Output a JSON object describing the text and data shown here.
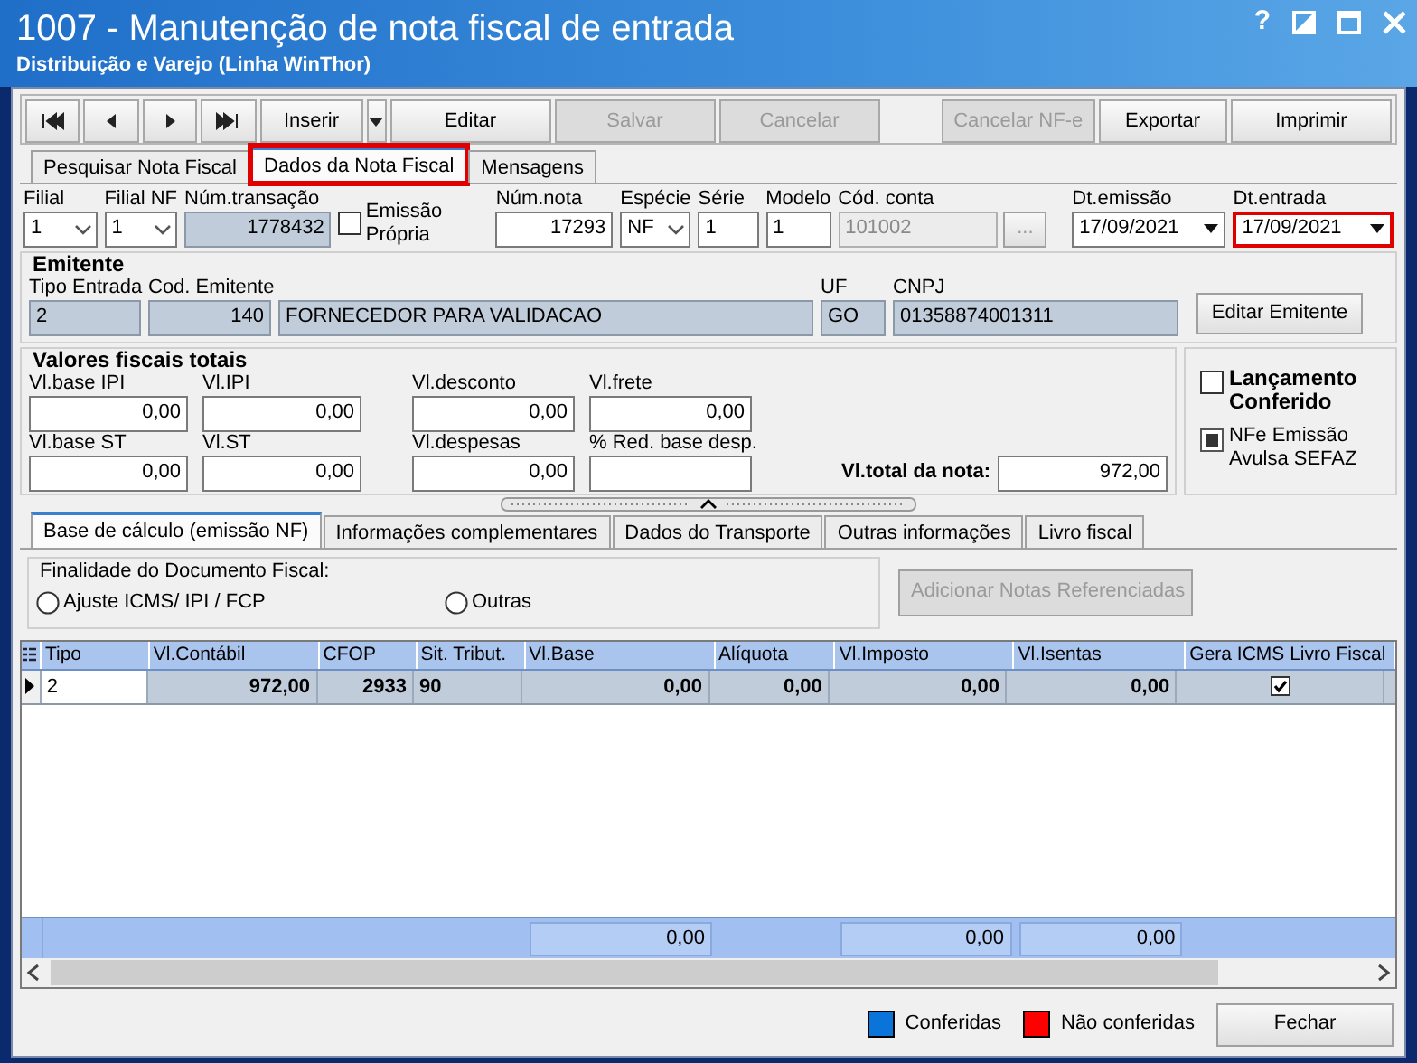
{
  "window": {
    "title": "1007 - Manutenção de nota fiscal de entrada",
    "subtitle": "Distribuição e Varejo (Linha WinThor)",
    "controls": [
      {
        "kind": "help",
        "label": "?"
      },
      {
        "kind": "restore"
      },
      {
        "kind": "maximize"
      },
      {
        "kind": "close"
      }
    ]
  },
  "toolbar": [
    {
      "kind": "first",
      "disabled": false
    },
    {
      "kind": "prev",
      "disabled": false
    },
    {
      "kind": "next",
      "disabled": false
    },
    {
      "kind": "last",
      "disabled": false
    },
    {
      "kind": "split",
      "label": "Inserir",
      "disabled": false
    },
    {
      "kind": "text",
      "label": "Editar",
      "disabled": false
    },
    {
      "kind": "text",
      "label": "Salvar",
      "disabled": true
    },
    {
      "kind": "text",
      "label": "Cancelar",
      "disabled": true
    },
    {
      "kind": "gap"
    },
    {
      "kind": "text",
      "label": "Cancelar NF-e",
      "disabled": true
    },
    {
      "kind": "text",
      "label": "Exportar",
      "disabled": false
    },
    {
      "kind": "text",
      "label": "Imprimir",
      "disabled": false
    }
  ],
  "tabs": [
    {
      "label": "Pesquisar Nota Fiscal",
      "selected": false,
      "highlighted": false
    },
    {
      "label": "Dados da Nota Fiscal",
      "selected": true,
      "highlighted": true
    },
    {
      "label": "Mensagens",
      "selected": false,
      "highlighted": false
    }
  ],
  "header_fields": [
    {
      "label": "Filial",
      "value": "1",
      "kind": "select",
      "highlighted": false
    },
    {
      "label": "Filial NF",
      "value": "1",
      "kind": "select",
      "highlighted": false
    },
    {
      "label": "Núm.transação",
      "value": "1778432",
      "kind": "readonly",
      "highlighted": false
    },
    {
      "label": "Emissão Própria",
      "kind": "checkbox",
      "checked": false,
      "highlighted": false
    },
    {
      "label": "Núm.nota",
      "value": "17293",
      "kind": "number",
      "highlighted": false
    },
    {
      "label": "Espécie",
      "value": "NF",
      "kind": "select",
      "highlighted": false
    },
    {
      "label": "Série",
      "value": "1",
      "kind": "text",
      "highlighted": false
    },
    {
      "label": "Modelo",
      "value": "1",
      "kind": "text",
      "highlighted": false
    },
    {
      "label": "Cód. conta",
      "value": "101002",
      "kind": "lookup",
      "button": "...",
      "highlighted": false
    },
    {
      "label": "Dt.emissão",
      "value": "17/09/2021",
      "kind": "date",
      "highlighted": false
    },
    {
      "label": "Dt.entrada",
      "value": "17/09/2021",
      "kind": "date",
      "highlighted": true
    }
  ],
  "emitente": {
    "title": "Emitente",
    "fields": [
      {
        "label": "Tipo Entrada",
        "value": "2",
        "kind": "text"
      },
      {
        "label": "Cod. Emitente",
        "value": "140",
        "kind": "number"
      },
      {
        "value": "FORNECEDOR PARA VALIDACAO",
        "kind": "text"
      },
      {
        "label": "UF",
        "value": "GO",
        "kind": "text"
      },
      {
        "label": "CNPJ",
        "value": "01358874001311",
        "kind": "text"
      }
    ],
    "button": "Editar Emitente"
  },
  "valores": {
    "title": "Valores fiscais totais",
    "rows": [
      [
        {
          "label": "Vl.base IPI",
          "value": "0,00"
        },
        {
          "label": "Vl.IPI",
          "value": "0,00"
        },
        {
          "label": "Vl.desconto",
          "value": "0,00"
        },
        {
          "label": "Vl.frete",
          "value": "0,00"
        }
      ],
      [
        {
          "label": "Vl.base ST",
          "value": "0,00"
        },
        {
          "label": "Vl.ST",
          "value": "0,00"
        },
        {
          "label": "Vl.despesas",
          "value": "0,00"
        },
        {
          "label": "% Red. base desp."
        }
      ]
    ],
    "total_label": "Vl.total da nota:",
    "total_value": "972,00"
  },
  "status_checks": [
    {
      "label": "Lançamento Conferido",
      "checked": false,
      "disabled": false
    },
    {
      "label": "NFe Emissão Avulsa SEFAZ",
      "checked": true,
      "disabled": true
    }
  ],
  "subtabs": [
    {
      "label": "Base de cálculo (emissão NF)",
      "selected": true
    },
    {
      "label": "Informações complementares",
      "selected": false
    },
    {
      "label": "Dados do Transporte",
      "selected": false
    },
    {
      "label": "Outras informações",
      "selected": false
    },
    {
      "label": "Livro fiscal",
      "selected": false
    }
  ],
  "finalidade": {
    "legend": "Finalidade do Documento Fiscal:",
    "options": [
      {
        "label": "Ajuste ICMS/ IPI / FCP",
        "selected": false
      },
      {
        "label": "Outras",
        "selected": false
      }
    ]
  },
  "add_button": {
    "label": "Adicionar Notas Referenciadas",
    "disabled": true
  },
  "grid": {
    "columns": [
      {
        "label": "Tipo",
        "kind": "edit"
      },
      {
        "label": "Vl.Contábil",
        "kind": "number"
      },
      {
        "label": "CFOP",
        "kind": "number"
      },
      {
        "label": "Sit. Tribut.",
        "kind": "text"
      },
      {
        "label": "Vl.Base",
        "kind": "number",
        "total": "0,00"
      },
      {
        "label": "Alíquota",
        "kind": "number"
      },
      {
        "label": "Vl.Imposto",
        "kind": "number",
        "total": "0,00"
      },
      {
        "label": "Vl.Isentas",
        "kind": "number",
        "total": "0,00"
      },
      {
        "label": "Gera ICMS Livro Fiscal",
        "kind": "check"
      }
    ],
    "rows": [
      {
        "selected": true,
        "cells": [
          "2",
          "972,00",
          "2933",
          "90",
          "0,00",
          "0,00",
          "0,00",
          "0,00"
        ],
        "gera_icms": true
      }
    ]
  },
  "legend": [
    {
      "label": "Conferidas",
      "color": "#0a74da"
    },
    {
      "label": "Não conferidas",
      "color": "#ff0000"
    }
  ],
  "close_button": "Fechar"
}
